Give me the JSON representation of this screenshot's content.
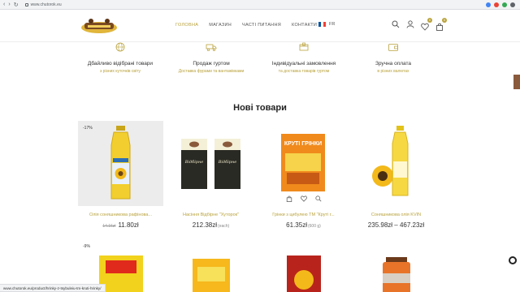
{
  "browser": {
    "url": "www.chutorok.eu"
  },
  "header": {
    "menu": [
      {
        "label": "ГОЛОВНА",
        "active": true
      },
      {
        "label": "МАГАЗИН",
        "active": false
      },
      {
        "label": "ЧАСТІ ПИТАННЯ",
        "active": false
      },
      {
        "label": "КОНТАКТИ",
        "active": false
      }
    ],
    "language": "FR",
    "wishlist_count": "0",
    "cart_count": "0"
  },
  "features": [
    {
      "title": "Дбайливо відібрані товари",
      "subtitle": "з різних куточків світу",
      "icon": "globe-icon"
    },
    {
      "title": "Продаж гуртом",
      "subtitle": "Доставка фурами та вантажівками",
      "icon": "truck-icon"
    },
    {
      "title": "Індивідуальні замовлення",
      "subtitle": "та доставка товарів гуртом",
      "icon": "box-icon"
    },
    {
      "title": "Зручна оплата",
      "subtitle": "в різних валютах",
      "icon": "wallet-icon"
    }
  ],
  "section_title": "Нові товари",
  "products": [
    {
      "name": "Олія соняшникова рафінова...",
      "price": "11.80zł",
      "old_price": "14.16zł",
      "discount": "-17%",
      "unit": ""
    },
    {
      "name": "Насіння Відбірне \"Хуторок\"",
      "price": "212.38zł",
      "old_price": "",
      "discount": "",
      "unit": "(each)"
    },
    {
      "name": "Грінки з цибулею ТМ \"Круті г...",
      "price": "61.35zł",
      "old_price": "",
      "discount": "",
      "unit": "(600 g)"
    },
    {
      "name": "Соняшникова олія KVIN",
      "price": "235.98zł – 467.23zł",
      "old_price": "",
      "discount": "",
      "unit": ""
    }
  ],
  "product_labels": {
    "seeds": "Відбірне",
    "croutons": "КРУТІ ГРІНКИ"
  },
  "products_row2": [
    {
      "discount": "-9%"
    },
    {
      "discount": ""
    },
    {
      "discount": ""
    },
    {
      "discount": ""
    }
  ],
  "status_url": "www.chutorok.eu/product/hrinky-z-tsybuleiu-tm-kruti-hrinky/",
  "colors": {
    "accent": "#b9a23c",
    "brand_brown": "#8a5a3c"
  }
}
